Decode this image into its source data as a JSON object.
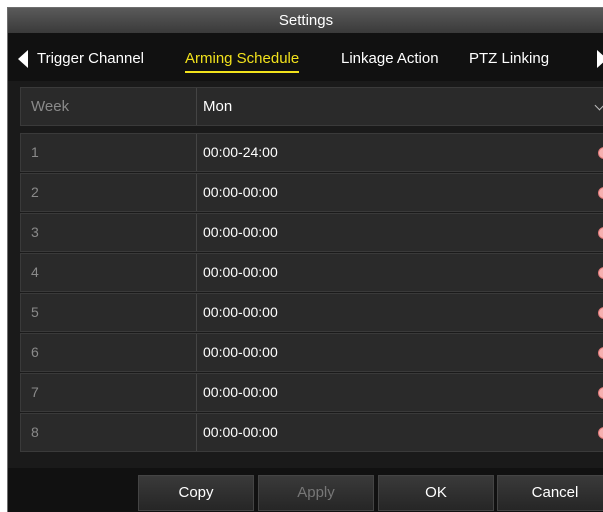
{
  "window": {
    "title": "Settings"
  },
  "tabs": [
    {
      "label": "Trigger Channel",
      "active": false
    },
    {
      "label": "Arming Schedule",
      "active": true
    },
    {
      "label": "Linkage Action",
      "active": false
    },
    {
      "label": "PTZ Linking",
      "active": false
    }
  ],
  "schedule": {
    "week_label": "Week",
    "week_value": "Mon",
    "rows": [
      {
        "index": "1",
        "time": "00:00-24:00"
      },
      {
        "index": "2",
        "time": "00:00-00:00"
      },
      {
        "index": "3",
        "time": "00:00-00:00"
      },
      {
        "index": "4",
        "time": "00:00-00:00"
      },
      {
        "index": "5",
        "time": "00:00-00:00"
      },
      {
        "index": "6",
        "time": "00:00-00:00"
      },
      {
        "index": "7",
        "time": "00:00-00:00"
      },
      {
        "index": "8",
        "time": "00:00-00:00"
      }
    ]
  },
  "buttons": {
    "copy": "Copy",
    "apply": "Apply",
    "ok": "OK",
    "cancel": "Cancel"
  },
  "colors": {
    "active_tab": "#f2e21c",
    "clock_icon": "#f6b0b0"
  }
}
